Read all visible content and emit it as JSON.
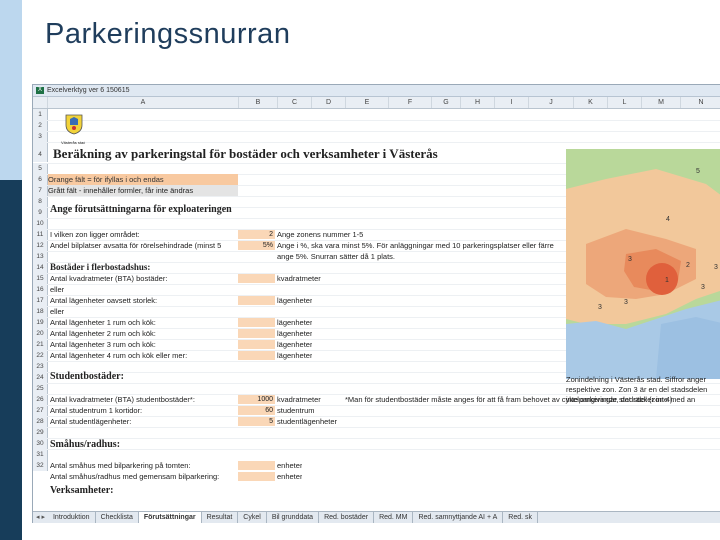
{
  "slide": {
    "title": "Parkeringssnurran"
  },
  "window": {
    "title": "Excelverktyg ver 6 150615"
  },
  "columns": [
    "A",
    "B",
    "C",
    "D",
    "E",
    "F",
    "G",
    "H",
    "I",
    "J",
    "K",
    "L",
    "M",
    "N"
  ],
  "rows": [
    {
      "n": "1"
    },
    {
      "n": "2"
    },
    {
      "n": "3"
    },
    {
      "n": "4"
    },
    {
      "n": "5"
    },
    {
      "n": "6"
    },
    {
      "n": "7"
    },
    {
      "n": "8"
    },
    {
      "n": "9"
    },
    {
      "n": "10"
    },
    {
      "n": "11"
    },
    {
      "n": "12"
    },
    {
      "n": "13"
    },
    {
      "n": "14"
    },
    {
      "n": "15"
    },
    {
      "n": "16"
    },
    {
      "n": "17"
    },
    {
      "n": "18"
    },
    {
      "n": "19"
    },
    {
      "n": "20"
    },
    {
      "n": "21"
    },
    {
      "n": "22"
    },
    {
      "n": "23"
    },
    {
      "n": "24"
    },
    {
      "n": "25"
    },
    {
      "n": "26"
    },
    {
      "n": "27"
    },
    {
      "n": "28"
    },
    {
      "n": "29"
    },
    {
      "n": "30"
    },
    {
      "n": "31"
    },
    {
      "n": "32"
    }
  ],
  "sheet": {
    "logo_caption": "Västerås stad",
    "main_heading": "Beräkning av parkeringstal för bostäder och verksamheter i Västerås",
    "legend_orange": "Orange fält = för ifyllas i och endas",
    "legend_grey": "Grått fält - innehåller formler, får inte ändras",
    "section_exploit": "Ange förutsättningarna för exploateringen",
    "r11_label": "I vilken zon ligger området:",
    "r11_value": "2",
    "r11_note": "Ange zonens nummer 1-5",
    "r12_label": "Andel bilplatser avsatta för rörelsehindrade (minst 5",
    "r12_value": "5%",
    "r12_note": "Ange i %, ska vara minst 5%. För anläggningar med 10 parkeringsplatser eller färre",
    "r13_note": "ange 5%. Snurran sätter då 1 plats.",
    "section_flerbostad": "Bostäder i flerbostadshus:",
    "r15_label": "Antal kvadratmeter (BTA) bostäder:",
    "r15_unit": "kvadratmeter",
    "r16_label": "eller",
    "r17_label": "Antal lägenheter oavsett storlek:",
    "r17_unit": "lägenheter",
    "r18_label": "eller",
    "r19_label": "Antal lägenheter 1 rum och kök:",
    "r19_unit": "lägenheter",
    "r20_label": "Antal lägenheter 2 rum och kök:",
    "r20_unit": "lägenheter",
    "r21_label": "Antal lägenheter 3 rum och kök:",
    "r21_unit": "lägenheter",
    "r22_label": "Antal lägenheter 4 rum och kök eller mer:",
    "r22_unit": "lägenheter",
    "section_student": "Studentbostäder:",
    "r25_label": "Antal kvadratmeter (BTA) studentbostäder*:",
    "r25_value": "1000",
    "r25_unit": "kvadratmeter",
    "r25_note": "*Man för studentbostäder måste anges för att få fram behovet av cykelparkeringar, det räcker inte med an",
    "r26_label": "Antal studentrum 1 kortidor:",
    "r26_value": "60",
    "r26_unit": "studentrum",
    "r27_label": "Antal studentlägenheter:",
    "r27_value": "5",
    "r27_unit": "studentlägenheter",
    "section_smahus": "Småhus/radhus:",
    "r30_label": "Antal småhus med bilparkering på tomten:",
    "r30_unit": "enheter",
    "r31_label": "Antal småhus/radhus med gemensam bilparkering:",
    "r31_unit": "enheter",
    "section_verksamheter": "Verksamheter:"
  },
  "map": {
    "zone_labels": [
      "5",
      "4",
      "3",
      "2",
      "1",
      "3",
      "3",
      "3",
      "3"
    ],
    "caption_lines": [
      "Zonindelning i Västerås stad. Siffror anger",
      "respektive zon. Zon 3 är en del stadsdelen",
      "inte omgivande stadsdel (zon 4)."
    ]
  },
  "tabs": [
    "Introduktion",
    "Checklista",
    "Förutsättningar",
    "Resultat",
    "Cykel",
    "Bil grunddata",
    "Red. bostäder",
    "Red. MM",
    "Red. samnyttjande AI + A",
    "Red. sk"
  ],
  "active_tab": 2,
  "colors": {
    "orange_field": "#fad7b7",
    "grey_field": "#e4e4e4",
    "sidebar_light": "#bcd7ee",
    "sidebar_dark": "#173d5a"
  }
}
